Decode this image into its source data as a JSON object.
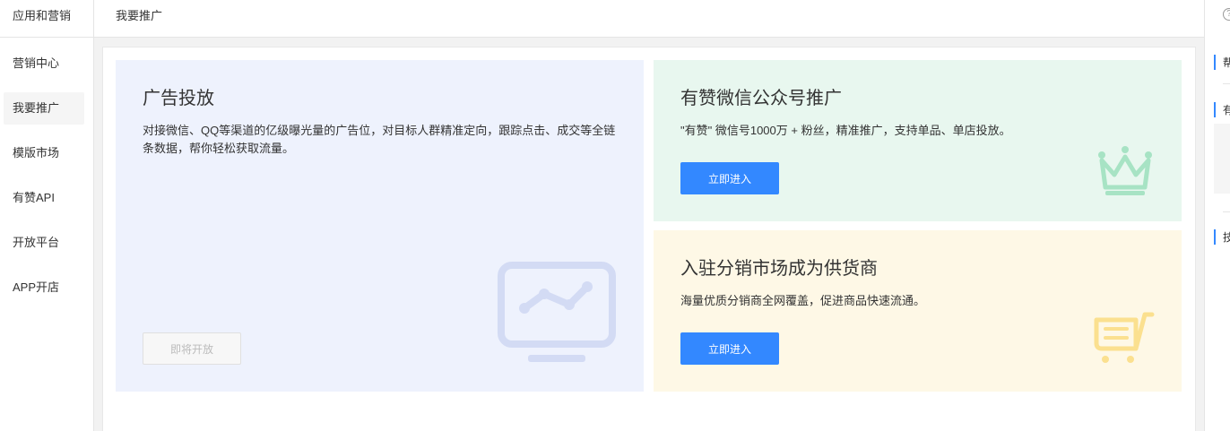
{
  "sidebar": {
    "title": "应用和营销",
    "items": [
      {
        "label": "营销中心",
        "active": false
      },
      {
        "label": "我要推广",
        "active": true
      },
      {
        "label": "模版市场",
        "active": false
      },
      {
        "label": "有赞API",
        "active": false
      },
      {
        "label": "开放平台",
        "active": false
      },
      {
        "label": "APP开店",
        "active": false
      }
    ]
  },
  "topbar": {
    "title": "我要推广"
  },
  "rightbar": {
    "help_icon": "question-circle-icon",
    "items": [
      "帮",
      "有",
      "技"
    ]
  },
  "cards": {
    "ad": {
      "title": "广告投放",
      "desc": "对接微信、QQ等渠道的亿级曝光量的广告位，对目标人群精准定向，跟踪点击、成交等全链条数据，帮你轻松获取流量。",
      "button": "即将开放",
      "icon": "monitor-chart-icon",
      "bg": "#eef2fd",
      "icon_color": "#d3dbf4"
    },
    "wechat": {
      "title": "有赞微信公众号推广",
      "desc": "\"有赞\" 微信号1000万 + 粉丝，精准推广，支持单品、单店投放。",
      "button": "立即进入",
      "icon": "crown-icon",
      "bg": "#e8f7ef",
      "icon_color": "#a7e3c4"
    },
    "distribution": {
      "title": "入驻分销市场成为供货商",
      "desc": "海量优质分销商全网覆盖，促进商品快速流通。",
      "button": "立即进入",
      "icon": "cart-icon",
      "bg": "#fef8e6",
      "icon_color": "#fbe08f"
    }
  },
  "colors": {
    "primary": "#3388ff",
    "accent_bar": "#3388ff"
  }
}
